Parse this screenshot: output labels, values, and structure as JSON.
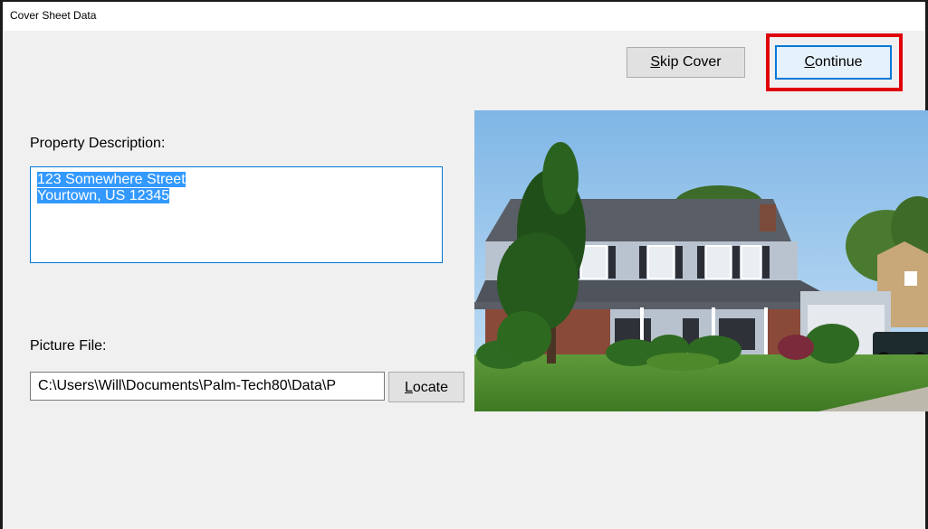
{
  "window": {
    "title": "Cover Sheet Data"
  },
  "toolbar": {
    "skip_cover": {
      "mnemonic": "S",
      "rest": "kip Cover"
    },
    "continue": {
      "mnemonic": "C",
      "rest": "ontinue"
    }
  },
  "property": {
    "label": "Property Description:",
    "lines": [
      "123 Somewhere Street",
      "Yourtown, US 12345"
    ]
  },
  "picture": {
    "label": "Picture File:",
    "path": "C:\\Users\\Will\\Documents\\Palm-Tech80\\Data\\P",
    "locate": {
      "mnemonic": "L",
      "rest": "ocate"
    }
  },
  "colors": {
    "accent": "#0078d7",
    "highlight": "#e0000a",
    "selection": "#3399ff"
  }
}
